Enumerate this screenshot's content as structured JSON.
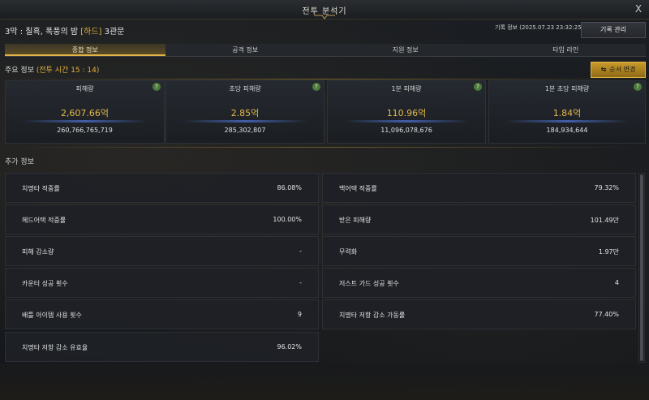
{
  "window": {
    "title": "전투 분석기",
    "close": "X"
  },
  "header": {
    "raid_title_prefix": "3막 : 칠흑, 폭풍의 밤 ",
    "raid_difficulty": "[하드]",
    "raid_gate": " 3관문",
    "record_info": "기록 정보 (2025.07.23 23:32:25)",
    "record_button": "기록 관리"
  },
  "tabs": [
    {
      "label": "종합 정보",
      "active": true
    },
    {
      "label": "공격 정보",
      "active": false
    },
    {
      "label": "지원 정보",
      "active": false
    },
    {
      "label": "타임 라인",
      "active": false
    }
  ],
  "main_info": {
    "label": "주요 정보 ",
    "time_label": "(전투 시간 15 : 14)",
    "order_button": "순서 변경"
  },
  "cards": [
    {
      "label": "피해량",
      "value": "2,607.66억",
      "sub": "260,766,765,719"
    },
    {
      "label": "초당 피해량",
      "value": "2.85억",
      "sub": "285,302,807"
    },
    {
      "label": "1분 피해량",
      "value": "110.96억",
      "sub": "11,096,078,676"
    },
    {
      "label": "1분 초당 피해량",
      "value": "1.84억",
      "sub": "184,934,644"
    }
  ],
  "extra": {
    "label": "추가 정보",
    "left": [
      {
        "label": "치명타 적중률",
        "value": "86.08%"
      },
      {
        "label": "헤드어택 적중률",
        "value": "100.00%"
      },
      {
        "label": "피해 감소량",
        "value": "-"
      },
      {
        "label": "카운터 성공 횟수",
        "value": "-"
      },
      {
        "label": "배틀 아이템 사용 횟수",
        "value": "9"
      },
      {
        "label": "치명타 저항 감소 유효율",
        "value": "96.02%"
      }
    ],
    "right": [
      {
        "label": "백어택 적중률",
        "value": "79.32%"
      },
      {
        "label": "받은 피해량",
        "value": "101.49만"
      },
      {
        "label": "무력화",
        "value": "1.97만"
      },
      {
        "label": "저스트 가드 성공 횟수",
        "value": "4"
      },
      {
        "label": "치명타 저항 감소 가동률",
        "value": "77.40%"
      }
    ]
  },
  "colors": {
    "accent": "#e2b13c",
    "help": "#4d7a3a"
  }
}
